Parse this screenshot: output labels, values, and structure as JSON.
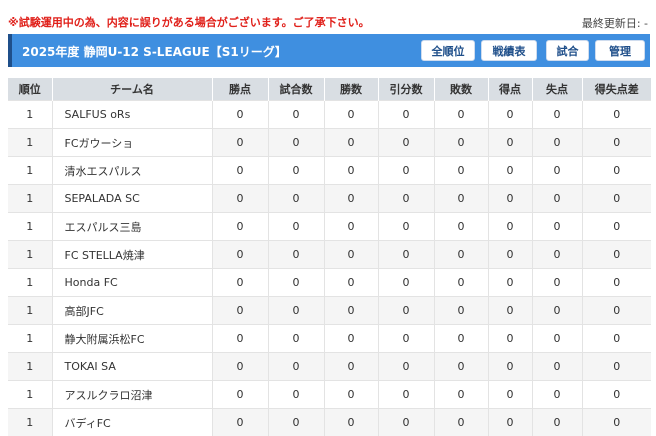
{
  "notice": "※試験運用中の為、内容に誤りがある場合がございます。ご了承下さい。",
  "last_updated": "最終更新日: -",
  "header": {
    "title": "2025年度 静岡U-12 S-LEAGUE【S1リーグ】",
    "buttons": [
      "全順位",
      "戦績表",
      "試合",
      "管理"
    ]
  },
  "colors": {
    "header_bg": "#3f8fe0",
    "notice_text": "#e0201a",
    "table_header_bg": "#d9dee3"
  },
  "table": {
    "columns": [
      "順位",
      "チーム名",
      "勝点",
      "試合数",
      "勝数",
      "引分数",
      "敗数",
      "得点",
      "失点",
      "得失点差"
    ],
    "rows": [
      [
        "1",
        "SALFUS oRs",
        "0",
        "0",
        "0",
        "0",
        "0",
        "0",
        "0",
        "0"
      ],
      [
        "1",
        "FCガウーショ",
        "0",
        "0",
        "0",
        "0",
        "0",
        "0",
        "0",
        "0"
      ],
      [
        "1",
        "清水エスパルス",
        "0",
        "0",
        "0",
        "0",
        "0",
        "0",
        "0",
        "0"
      ],
      [
        "1",
        "SEPALADA SC",
        "0",
        "0",
        "0",
        "0",
        "0",
        "0",
        "0",
        "0"
      ],
      [
        "1",
        "エスパルス三島",
        "0",
        "0",
        "0",
        "0",
        "0",
        "0",
        "0",
        "0"
      ],
      [
        "1",
        "FC STELLA焼津",
        "0",
        "0",
        "0",
        "0",
        "0",
        "0",
        "0",
        "0"
      ],
      [
        "1",
        "Honda FC",
        "0",
        "0",
        "0",
        "0",
        "0",
        "0",
        "0",
        "0"
      ],
      [
        "1",
        "高部JFC",
        "0",
        "0",
        "0",
        "0",
        "0",
        "0",
        "0",
        "0"
      ],
      [
        "1",
        "静大附属浜松FC",
        "0",
        "0",
        "0",
        "0",
        "0",
        "0",
        "0",
        "0"
      ],
      [
        "1",
        "TOKAI SA",
        "0",
        "0",
        "0",
        "0",
        "0",
        "0",
        "0",
        "0"
      ],
      [
        "1",
        "アスルクラロ沼津",
        "0",
        "0",
        "0",
        "0",
        "0",
        "0",
        "0",
        "0"
      ],
      [
        "1",
        "バディFC",
        "0",
        "0",
        "0",
        "0",
        "0",
        "0",
        "0",
        "0"
      ]
    ]
  }
}
